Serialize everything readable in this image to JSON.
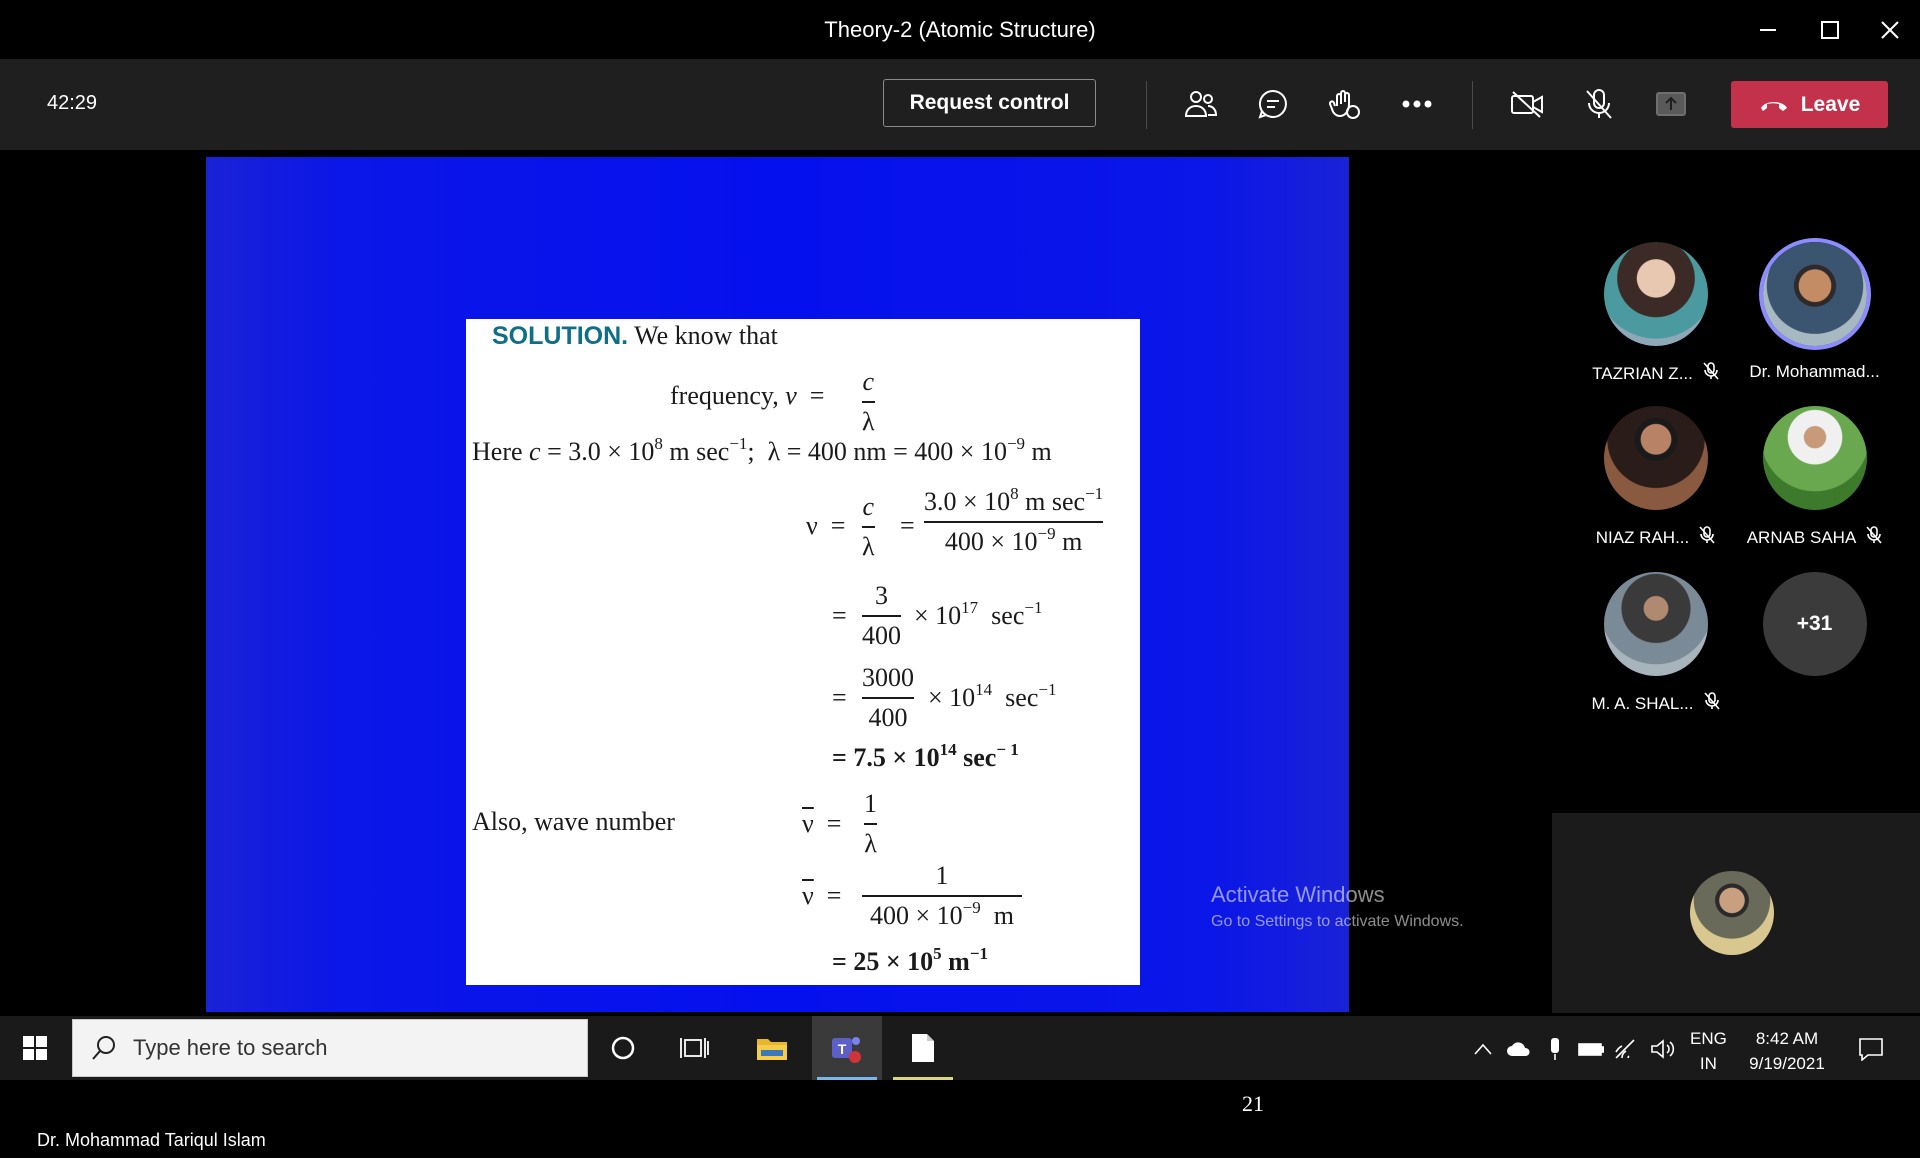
{
  "window": {
    "title": "Theory-2 (Atomic Structure)"
  },
  "toolbar": {
    "timer": "42:29",
    "request_control": "Request control",
    "leave": "Leave"
  },
  "slide": {
    "solution_label": "SOLUTION.",
    "intro": "We know that",
    "frequency_label": "frequency,",
    "here_line_a": "Here",
    "also_wave_number": "Also, wave number",
    "page_number": "21"
  },
  "activate_windows": {
    "title": "Activate Windows",
    "subtitle": "Go to Settings to activate Windows."
  },
  "presenter_name": "Dr. Mohammad Tariqul Islam",
  "participants": [
    {
      "name": "TAZRIAN Z...",
      "muted": true,
      "color": "#6d8aa0"
    },
    {
      "name": "Dr. Mohammad...",
      "muted": false,
      "active": true,
      "color": "#5c7a8c"
    },
    {
      "name": "NIAZ RAH...",
      "muted": true,
      "color": "#6b4e3e"
    },
    {
      "name": "ARNAB SAHA",
      "muted": true,
      "color": "#4f8a3a"
    },
    {
      "name": "M. A. SHAL...",
      "muted": true,
      "color": "#7a8a96"
    }
  ],
  "overflow_count": "+31",
  "taskbar": {
    "search_placeholder": "Type here to search",
    "lang_top": "ENG",
    "lang_bottom": "IN",
    "time": "8:42 AM",
    "date": "9/19/2021"
  },
  "icons": [
    "people-icon",
    "chat-icon",
    "raise-hand-icon",
    "more-icon",
    "camera-off-icon",
    "mic-off-icon",
    "share-icon",
    "phone-hangup-icon"
  ]
}
